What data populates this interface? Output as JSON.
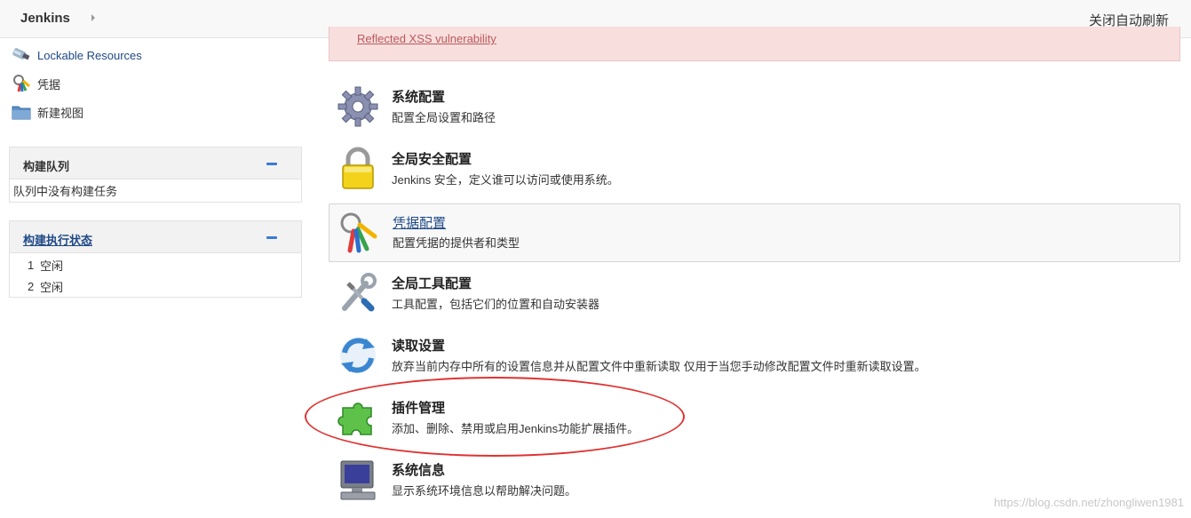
{
  "header": {
    "brand": "Jenkins",
    "auto_refresh": "关闭自动刷新"
  },
  "sidebar": {
    "links": [
      {
        "label": "Lockable Resources",
        "icon": "usb-drive-icon"
      },
      {
        "label": "凭据",
        "icon": "keys-icon"
      },
      {
        "label": "新建视图",
        "icon": "folder-icon"
      }
    ],
    "build_queue": {
      "title": "构建队列",
      "empty_text": "队列中没有构建任务"
    },
    "executors": {
      "title": "构建执行状态",
      "rows": [
        {
          "num": "1",
          "status": "空闲"
        },
        {
          "num": "2",
          "status": "空闲"
        }
      ]
    }
  },
  "alert": {
    "link": "Reflected XSS vulnerability"
  },
  "entries": [
    {
      "title": "系统配置",
      "desc": "配置全局设置和路径",
      "icon": "gear-icon"
    },
    {
      "title": "全局安全配置",
      "desc": "Jenkins 安全，定义谁可以访问或使用系统。",
      "icon": "padlock-icon"
    },
    {
      "title": "凭据配置",
      "desc": "配置凭据的提供者和类型",
      "icon": "keys-icon"
    },
    {
      "title": "全局工具配置",
      "desc": "工具配置，包括它们的位置和自动安装器",
      "icon": "tools-icon"
    },
    {
      "title": "读取设置",
      "desc": "放弃当前内存中所有的设置信息并从配置文件中重新读取 仅用于当您手动修改配置文件时重新读取设置。",
      "icon": "reload-icon"
    },
    {
      "title": "插件管理",
      "desc": "添加、删除、禁用或启用Jenkins功能扩展插件。",
      "icon": "puzzle-icon"
    },
    {
      "title": "系统信息",
      "desc": "显示系统环境信息以帮助解决问题。",
      "icon": "monitor-icon"
    }
  ],
  "watermark": "https://blog.csdn.net/zhongliwen1981"
}
